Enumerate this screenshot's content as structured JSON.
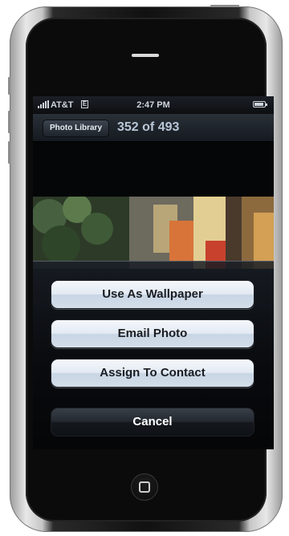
{
  "status_bar": {
    "carrier": "AT&T",
    "network_icon": "edge-icon",
    "network_label": "E",
    "time": "2:47 PM",
    "battery_icon": "battery-icon",
    "signal_icon": "signal-icon"
  },
  "nav_bar": {
    "back_label": "Photo Library",
    "title": "352 of 493"
  },
  "action_sheet": {
    "buttons": [
      {
        "label": "Use As Wallpaper"
      },
      {
        "label": "Email Photo"
      },
      {
        "label": "Assign To Contact"
      }
    ],
    "cancel_label": "Cancel"
  },
  "device": {
    "home_button_icon": "home-square-icon"
  },
  "colors": {
    "sheet_button_light": "#dfe7f1",
    "sheet_button_dark": "#23282f",
    "title_color": "#b9c6d6"
  }
}
